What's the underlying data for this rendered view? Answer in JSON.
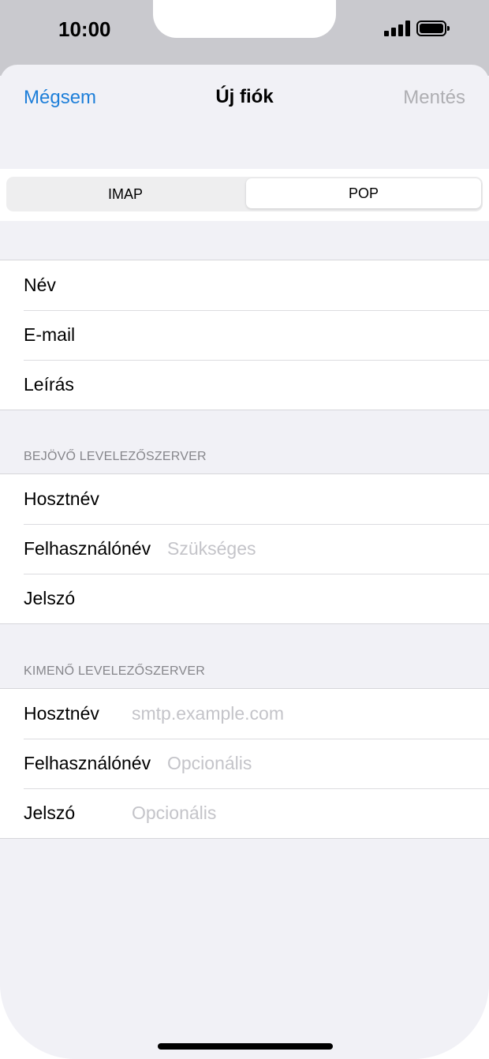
{
  "status": {
    "time": "10:00"
  },
  "nav": {
    "cancel": "Mégsem",
    "title": "Új fiók",
    "save": "Mentés"
  },
  "segment": {
    "options": [
      "IMAP",
      "POP"
    ],
    "selected": "POP"
  },
  "account": {
    "rows": [
      {
        "label": "Név",
        "value": ""
      },
      {
        "label": "E-mail",
        "value": ""
      },
      {
        "label": "Leírás",
        "value": ""
      }
    ]
  },
  "incoming": {
    "header": "BEJÖVŐ LEVELEZŐSZERVER",
    "rows": [
      {
        "label": "Hosztnév",
        "placeholder": ""
      },
      {
        "label": "Felhasználónév",
        "placeholder": "Szükséges"
      },
      {
        "label": "Jelszó",
        "placeholder": ""
      }
    ]
  },
  "outgoing": {
    "header": "KIMENŐ LEVELEZŐSZERVER",
    "rows": [
      {
        "label": "Hosztnév",
        "placeholder": "smtp.example.com"
      },
      {
        "label": "Felhasználónév",
        "placeholder": "Opcionális"
      },
      {
        "label": "Jelszó",
        "placeholder": "Opcionális"
      }
    ]
  },
  "colors": {
    "accent": "#1e7fd9",
    "disabled": "#aeaeb2",
    "placeholder": "#c4c4c9",
    "background": "#f1f1f6"
  }
}
